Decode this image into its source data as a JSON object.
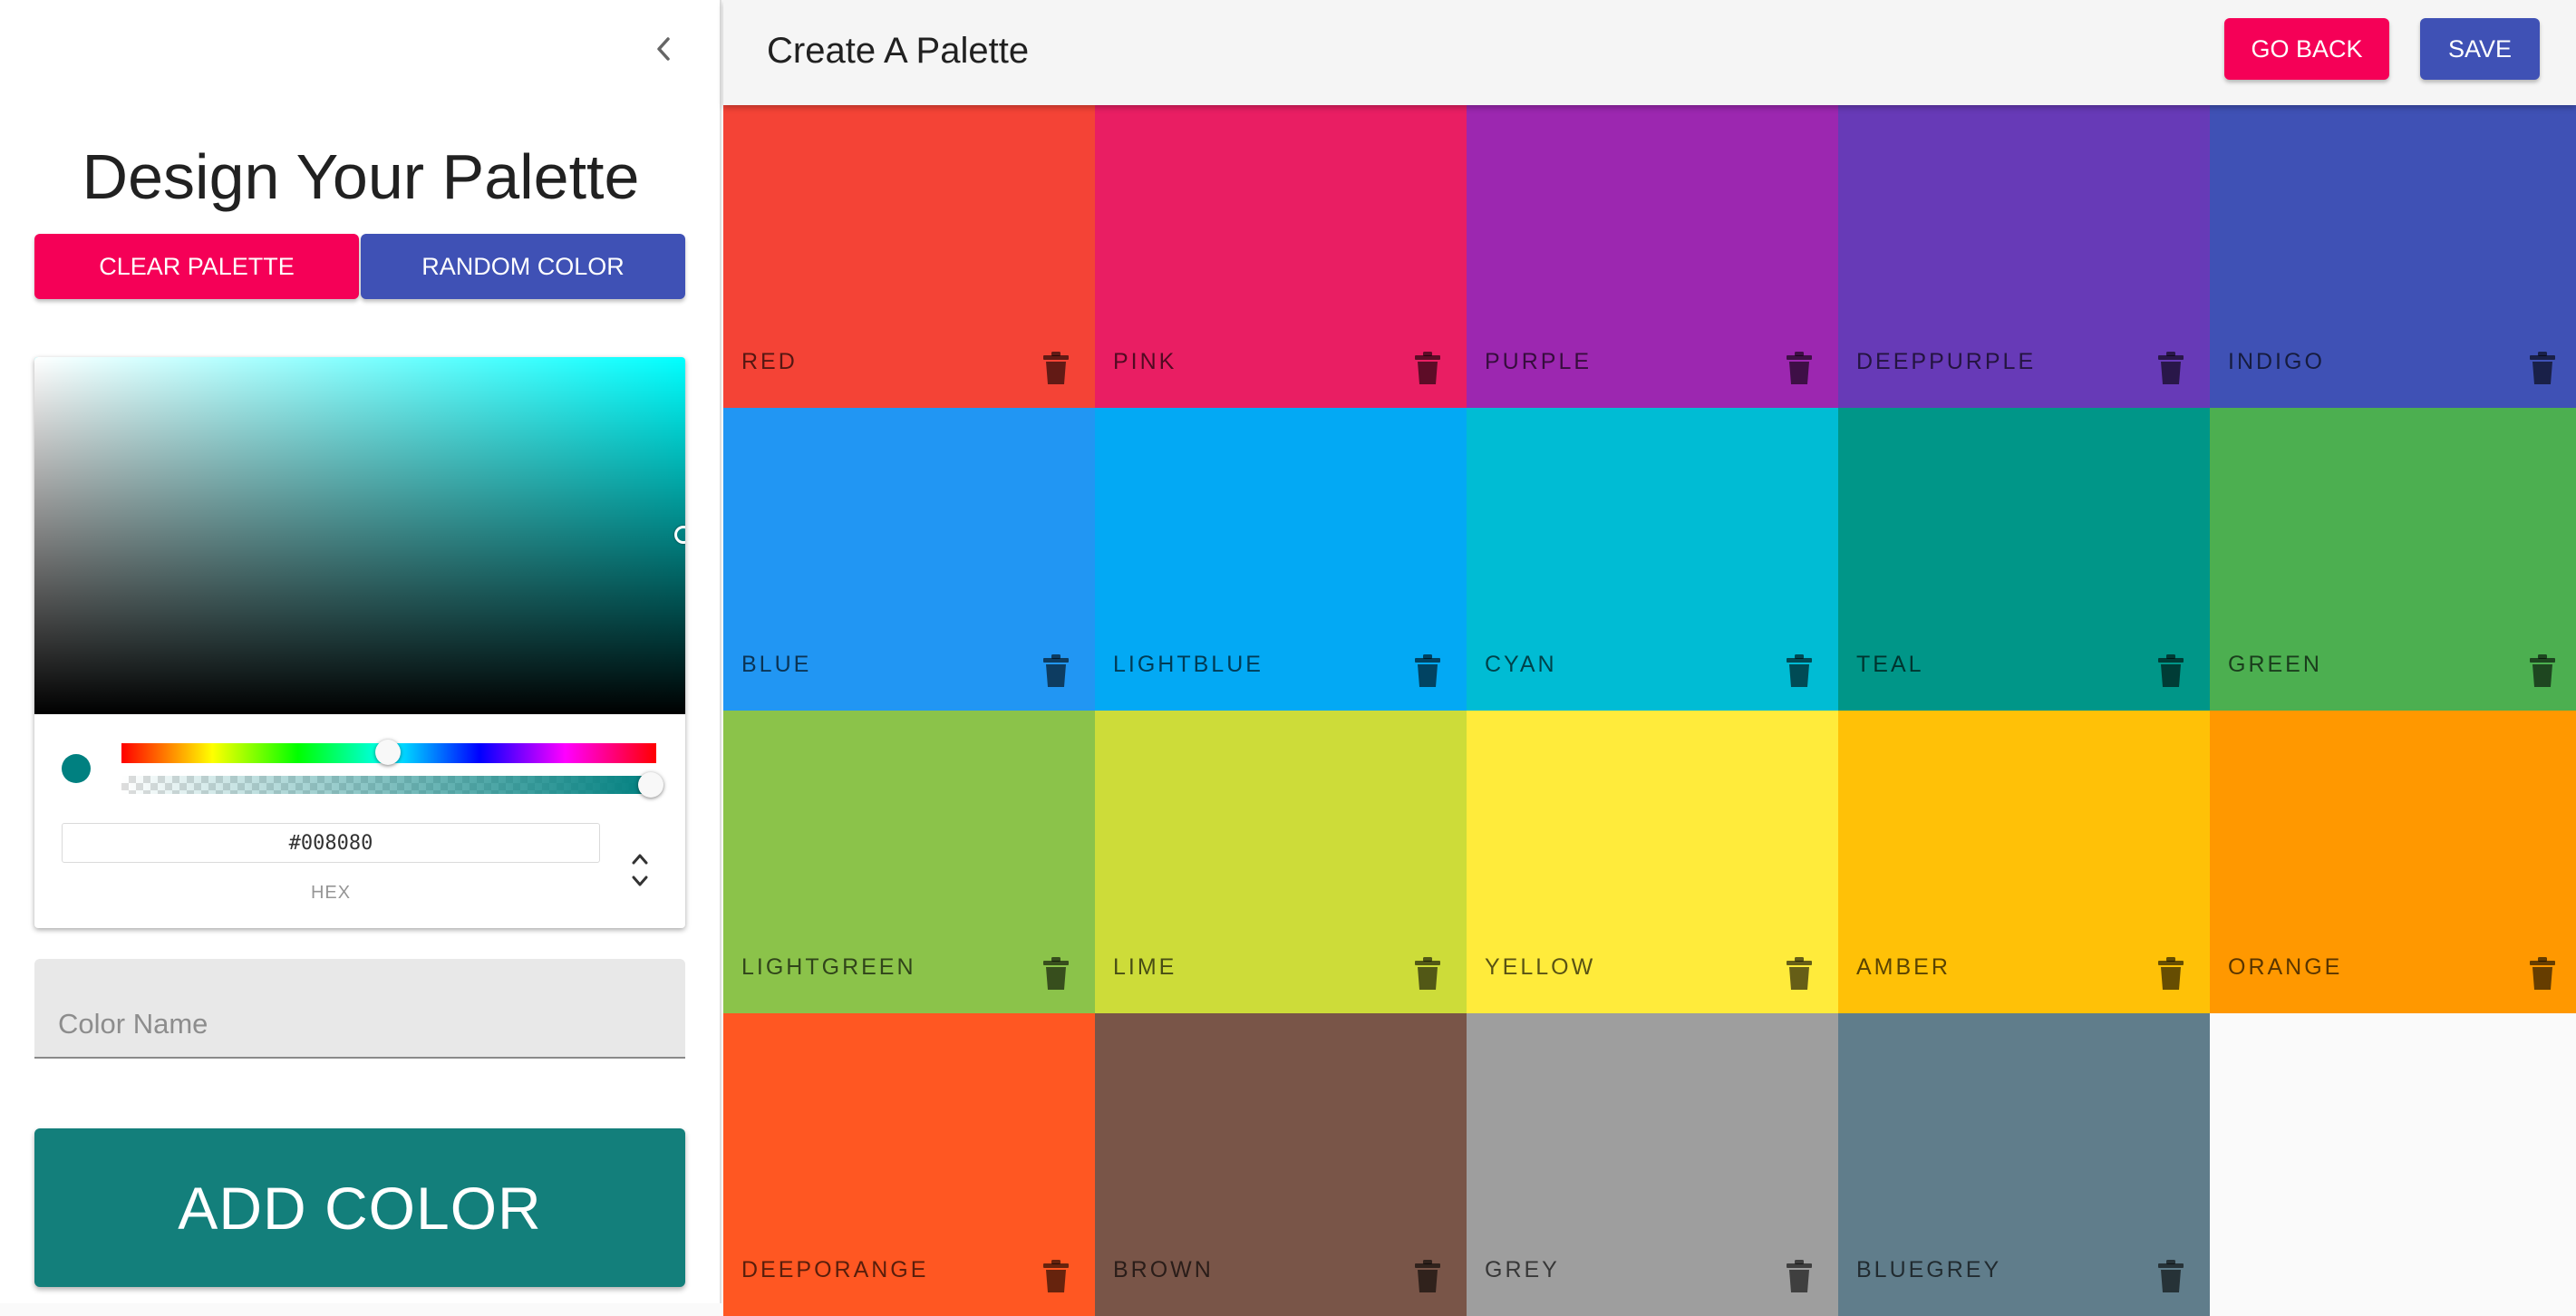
{
  "sidebar": {
    "title": "Design Your Palette",
    "clear_label": "CLEAR PALETTE",
    "random_label": "RANDOM COLOR",
    "picker": {
      "hex_value": "#008080",
      "hex_label": "HEX",
      "current_color": "#008080",
      "hue_color": "#00ffff"
    },
    "color_name": {
      "placeholder": "Color Name",
      "value": ""
    },
    "add_label": "ADD COLOR"
  },
  "appbar": {
    "title": "Create A Palette",
    "go_back_label": "GO BACK",
    "save_label": "SAVE"
  },
  "theme": {
    "pink": "#f50057",
    "indigo": "#3f51b5",
    "teal": "#137f7b"
  },
  "palette": [
    {
      "name": "RED",
      "color": "#F44336"
    },
    {
      "name": "PINK",
      "color": "#E91E63"
    },
    {
      "name": "PURPLE",
      "color": "#9C27B0"
    },
    {
      "name": "DEEPPURPLE",
      "color": "#673AB7"
    },
    {
      "name": "INDIGO",
      "color": "#3F51B5"
    },
    {
      "name": "BLUE",
      "color": "#2196F3"
    },
    {
      "name": "LIGHTBLUE",
      "color": "#03A9F4"
    },
    {
      "name": "CYAN",
      "color": "#00BCD4"
    },
    {
      "name": "TEAL",
      "color": "#009688"
    },
    {
      "name": "GREEN",
      "color": "#4CAF50"
    },
    {
      "name": "LIGHTGREEN",
      "color": "#8BC34A"
    },
    {
      "name": "LIME",
      "color": "#CDDC39"
    },
    {
      "name": "YELLOW",
      "color": "#FFEB3B"
    },
    {
      "name": "AMBER",
      "color": "#FFC107"
    },
    {
      "name": "ORANGE",
      "color": "#FF9800"
    },
    {
      "name": "DEEPORANGE",
      "color": "#FF5722"
    },
    {
      "name": "BROWN",
      "color": "#795548"
    },
    {
      "name": "GREY",
      "color": "#9E9E9E"
    },
    {
      "name": "BLUEGREY",
      "color": "#607D8B"
    }
  ]
}
